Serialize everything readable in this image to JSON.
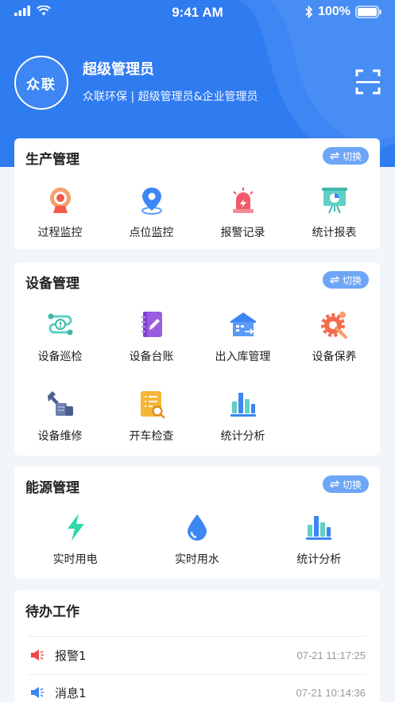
{
  "status_bar": {
    "time": "9:41 AM",
    "battery": "100%"
  },
  "profile": {
    "avatar_text": "众联",
    "name": "超级管理员",
    "subtitle": "众联环保 | 超级管理员&企业管理员"
  },
  "colors": {
    "primary": "#2f7bf0",
    "switch_bg": "#6ea6f7",
    "background": "#f2f5fa"
  },
  "production": {
    "title": "生产管理",
    "switch_label": "切换",
    "items": [
      {
        "label": "过程监控",
        "icon": "camera-icon"
      },
      {
        "label": "点位监控",
        "icon": "location-pin-icon"
      },
      {
        "label": "报警记录",
        "icon": "alarm-siren-icon"
      },
      {
        "label": "统计报表",
        "icon": "presentation-chart-icon"
      }
    ]
  },
  "equipment": {
    "title": "设备管理",
    "switch_label": "切换",
    "items": [
      {
        "label": "设备巡检",
        "icon": "inspection-route-icon"
      },
      {
        "label": "设备台账",
        "icon": "ledger-book-icon"
      },
      {
        "label": "出入库管理",
        "icon": "warehouse-icon"
      },
      {
        "label": "设备保养",
        "icon": "gear-wrench-icon"
      },
      {
        "label": "设备维修",
        "icon": "repair-tool-icon"
      },
      {
        "label": "开车检查",
        "icon": "checklist-search-icon"
      },
      {
        "label": "统计分析",
        "icon": "bar-chart-icon"
      }
    ]
  },
  "energy": {
    "title": "能源管理",
    "switch_label": "切换",
    "items": [
      {
        "label": "实时用电",
        "icon": "lightning-icon"
      },
      {
        "label": "实时用水",
        "icon": "water-drop-icon"
      },
      {
        "label": "统计分析",
        "icon": "bar-chart-icon"
      }
    ]
  },
  "todo": {
    "title": "待办工作",
    "items": [
      {
        "name": "报警1",
        "time": "07-21 11:17:25",
        "icon": "speaker-alarm-icon",
        "color": "#f04848"
      },
      {
        "name": "消息1",
        "time": "07-21 10:14:36",
        "icon": "speaker-message-icon",
        "color": "#3d86f4"
      }
    ]
  }
}
